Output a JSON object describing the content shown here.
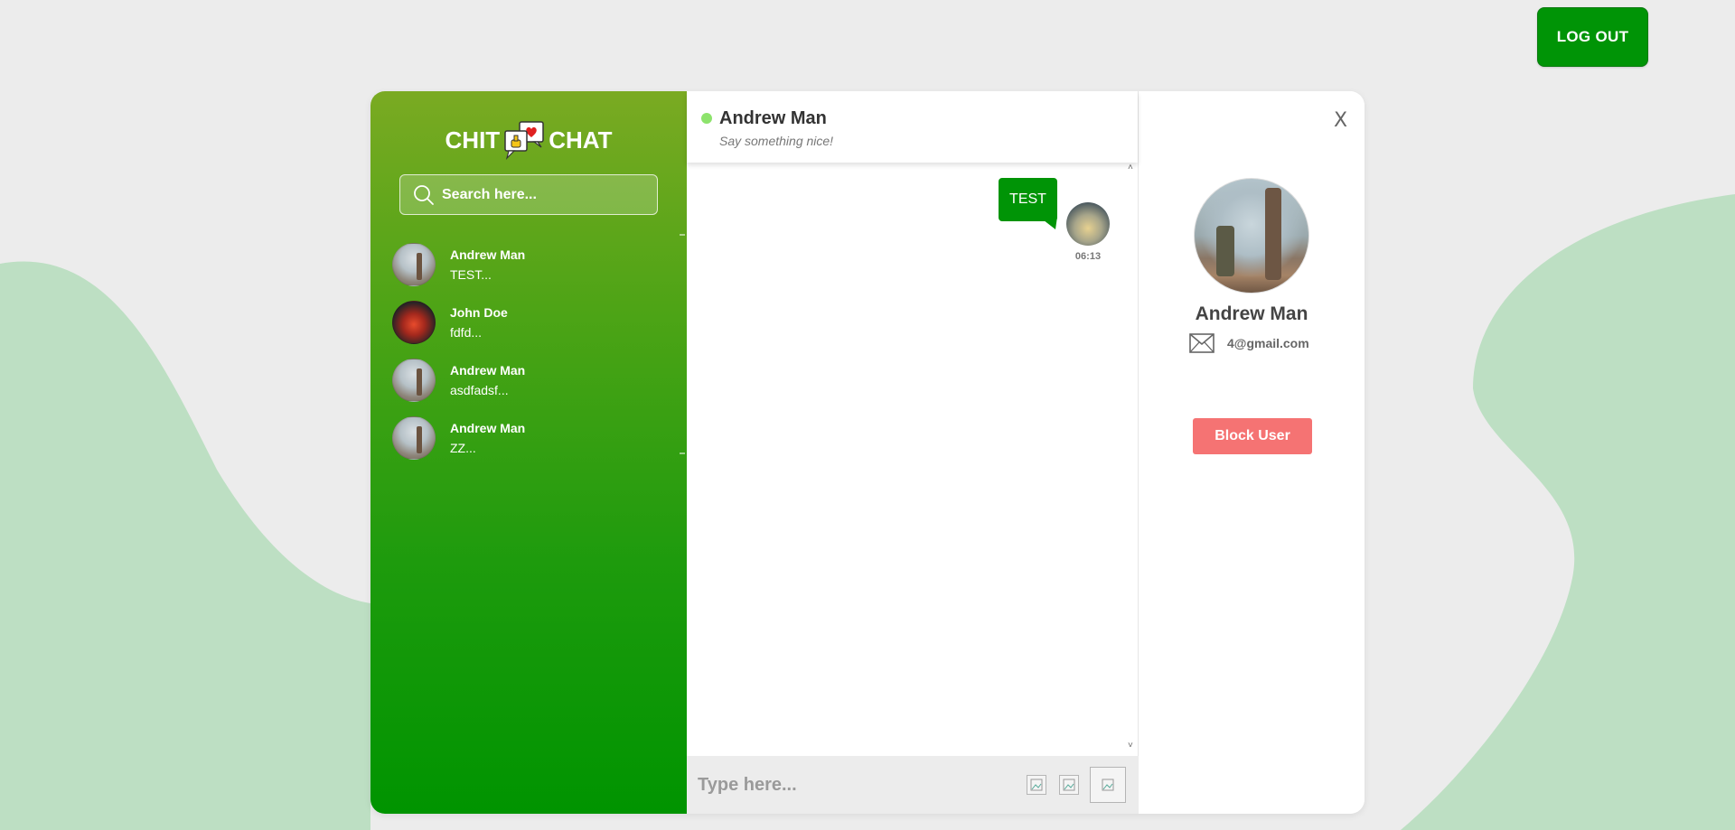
{
  "header": {
    "logout_label": "LOG OUT"
  },
  "brand": {
    "left": "CHIT",
    "right": "CHAT",
    "icon": "chat-bubbles-heart-icon"
  },
  "search": {
    "placeholder": "Search here...",
    "icon": "search-icon"
  },
  "contacts": [
    {
      "name": "Andrew Man",
      "preview": "TEST..."
    },
    {
      "name": "John Doe",
      "preview": "fdfd..."
    },
    {
      "name": "Andrew Man",
      "preview": "asdfadsf..."
    },
    {
      "name": "Andrew Man",
      "preview": "ZZ..."
    }
  ],
  "chat": {
    "contact_name": "Andrew Man",
    "status_text": "Say something nice!",
    "messages": [
      {
        "text": "TEST",
        "time": "06:13"
      }
    ],
    "composer_placeholder": "Type here..."
  },
  "profile": {
    "close_label": "X",
    "name": "Andrew Man",
    "email": "4@gmail.com",
    "email_icon": "envelope-icon",
    "block_label": "Block User"
  },
  "colors": {
    "accent": "#009406",
    "online": "#8de36c",
    "danger": "#f57373",
    "background": "#ececec",
    "blob": "#bddfc3"
  }
}
